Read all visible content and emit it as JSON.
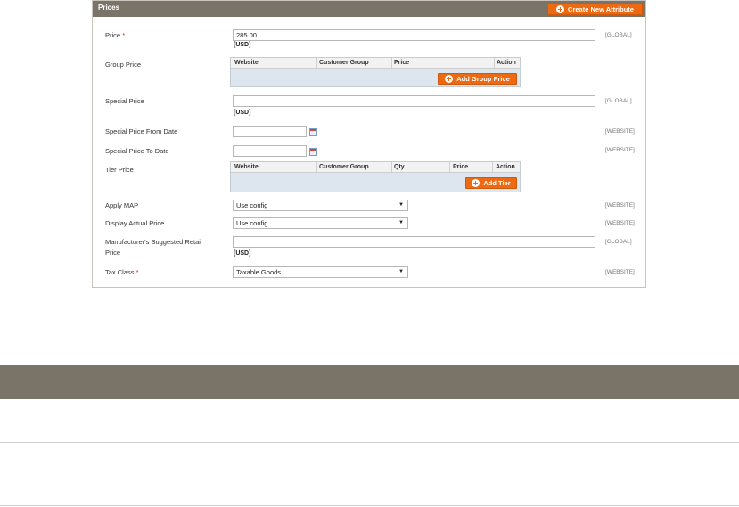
{
  "panel": {
    "title": "Prices",
    "create_attribute_label": "Create New Attribute"
  },
  "fields": {
    "price": {
      "label": "Price",
      "required_mark": "*",
      "value": "285.00",
      "unit": "[USD]",
      "scope": "[GLOBAL]"
    },
    "group_price": {
      "label": "Group Price",
      "columns": [
        "Website",
        "Customer Group",
        "Price",
        "Action"
      ],
      "add_label": "Add Group Price"
    },
    "special_price": {
      "label": "Special Price",
      "value": "",
      "unit": "[USD]",
      "scope": "[GLOBAL]"
    },
    "special_from": {
      "label": "Special Price From Date",
      "value": "",
      "scope": "[WEBSITE]"
    },
    "special_to": {
      "label": "Special Price To Date",
      "value": "",
      "scope": "[WEBSITE]"
    },
    "tier_price": {
      "label": "Tier Price",
      "columns": [
        "Website",
        "Customer Group",
        "Qty",
        "Price",
        "Action"
      ],
      "add_label": "Add Tier"
    },
    "apply_map": {
      "label": "Apply MAP",
      "value": "Use config",
      "scope": "[WEBSITE]"
    },
    "display_actual": {
      "label": "Display Actual Price",
      "value": "Use config",
      "scope": "[WEBSITE]"
    },
    "msrp": {
      "label_line1": "Manufacturer's Suggested Retail",
      "label_line2": "Price",
      "value": "",
      "unit": "[USD]",
      "scope": "[GLOBAL]"
    },
    "tax_class": {
      "label": "Tax Class",
      "required_mark": "*",
      "value": "Taxable Goods",
      "scope": "[WEBSITE]"
    }
  },
  "icons": {
    "add": "plus-circle-icon",
    "calendar": "calendar-icon",
    "dropdown": "chevron-down-icon"
  },
  "colors": {
    "accent": "#ee6a12",
    "header": "#7a7468",
    "grid_body": "#dde6ef"
  }
}
